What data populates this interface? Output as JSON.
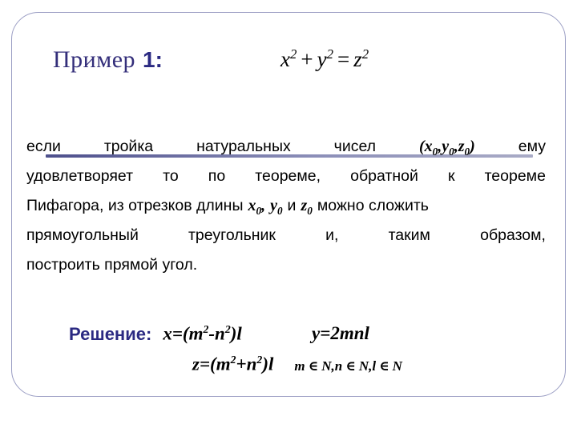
{
  "slide": {
    "title_word": "Пример",
    "title_number": "1:",
    "title_formula": {
      "x": "x",
      "x_exp": "2",
      "plus": "+",
      "y": "y",
      "y_exp": "2",
      "equals": "=",
      "z": "z",
      "z_exp": "2",
      "plain": "x² + y² = z²"
    },
    "body": {
      "line1": {
        "w1": "если",
        "w2": "тройка",
        "w3": "натуральных",
        "w4": "чисел",
        "triple_open": "(",
        "triple_x": "x",
        "triple_x_sub": "0",
        "triple_comma1": ",",
        "triple_y": "y",
        "triple_y_sub": "0",
        "triple_comma2": ",",
        "triple_z": "z",
        "triple_z_sub": "0",
        "triple_close": ")",
        "w5": "ему"
      },
      "line2": {
        "w1": "удовлетворяет",
        "w2": "то",
        "w3": "по",
        "w4": "теореме,",
        "w5": "обратной",
        "w6": "к",
        "w7": "теореме"
      },
      "line3": {
        "w1": "Пифагора, из отрезков длины",
        "vx": "x",
        "vx_sub": "0",
        "comma1": ",",
        "vy": "y",
        "vy_sub": "0",
        "w2": "и",
        "vz": "z",
        "vz_sub": "0",
        "w3": "можно сложить"
      },
      "line4": {
        "w1": "прямоугольный",
        "w2": "треугольник",
        "w3": "и,",
        "w4": "таким",
        "w5": "образом,"
      },
      "line5": {
        "w1": "построить прямой угол."
      }
    },
    "solution": {
      "label": "Решение:",
      "formula_x": {
        "lhs": "x=(",
        "m": "m",
        "m_exp": "2",
        "minus": "-",
        "n": "n",
        "n_exp": "2",
        "rhs": ")l",
        "plain": "x=(m²-n²)l"
      },
      "formula_y": {
        "plain": "y=2mnl"
      },
      "formula_z": {
        "lhs": "z=(",
        "m": "m",
        "m_exp": "2",
        "plus": "+",
        "n": "n",
        "n_exp": "2",
        "rhs": ")l",
        "plain": "z=(m²+n²)l"
      },
      "condition": {
        "m": "m",
        "in1": "∈",
        "N1": "N,",
        "n": "n",
        "in2": "∈",
        "N2": "N,",
        "l": "l",
        "in3": "∈",
        "N3": "N",
        "plain": "m ∈ N,n ∈ N,l ∈ N"
      }
    },
    "colors": {
      "frame_border": "#9b9ec4",
      "title_serif": "#332e7a",
      "title_number": "#2b2a82",
      "rule_dark": "#4d4f8c",
      "rule_light": "#a9abc6",
      "solution_label": "#2b2a82",
      "body_text": "#000000",
      "background": "#ffffff"
    }
  }
}
